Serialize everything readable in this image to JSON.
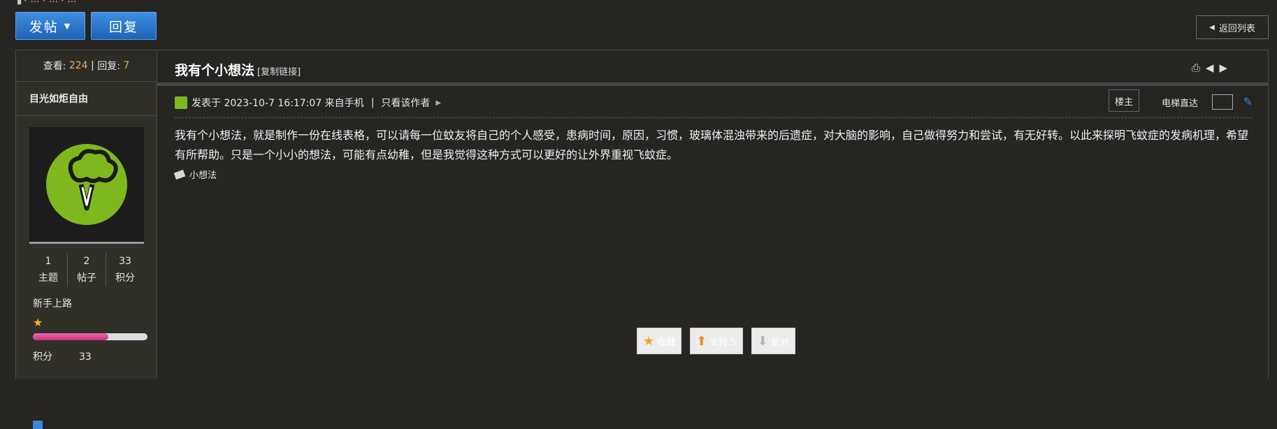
{
  "toolbar": {
    "post_label": "发帖",
    "reply_label": "回复",
    "back_label": "返回列表"
  },
  "sidebar": {
    "views_label": "查看:",
    "views": "224",
    "replies_label": "回复:",
    "replies": "7",
    "author": "目光如炬自由",
    "stats": [
      {
        "value": "1",
        "label": "主题"
      },
      {
        "value": "2",
        "label": "帖子"
      },
      {
        "value": "33",
        "label": "积分"
      }
    ],
    "rank": "新手上路",
    "progress": 0.66,
    "credit_label": "积分",
    "credit_value": "33"
  },
  "post": {
    "title": "我有个小想法",
    "copy_link": "[复制链接]",
    "posted": "发表于 2023-10-7 16:17:07 来自手机",
    "separator": "|",
    "author_only": "只看该作者",
    "floor": "楼主",
    "jump_label": "电梯直达",
    "content": "我有个小想法，就是制作一份在线表格，可以请每一位蚊友将自己的个人感受，患病时间，原因，习惯，玻璃体混浊带来的后遗症，对大脑的影响，自己做得努力和尝试，有无好转。以此来探明飞蚊症的发病机理，希望有所帮助。只是一个小小的想法，可能有点幼稚，但是我觉得这种方式可以更好的让外界重视飞蚊症。",
    "tag": "小想法"
  },
  "actions": {
    "favorite": "收藏",
    "support": "支持 5",
    "oppose": "反对"
  },
  "colors": {
    "accent": "#3d86d9",
    "bg": "#262522",
    "highlight": "#e8b062"
  }
}
